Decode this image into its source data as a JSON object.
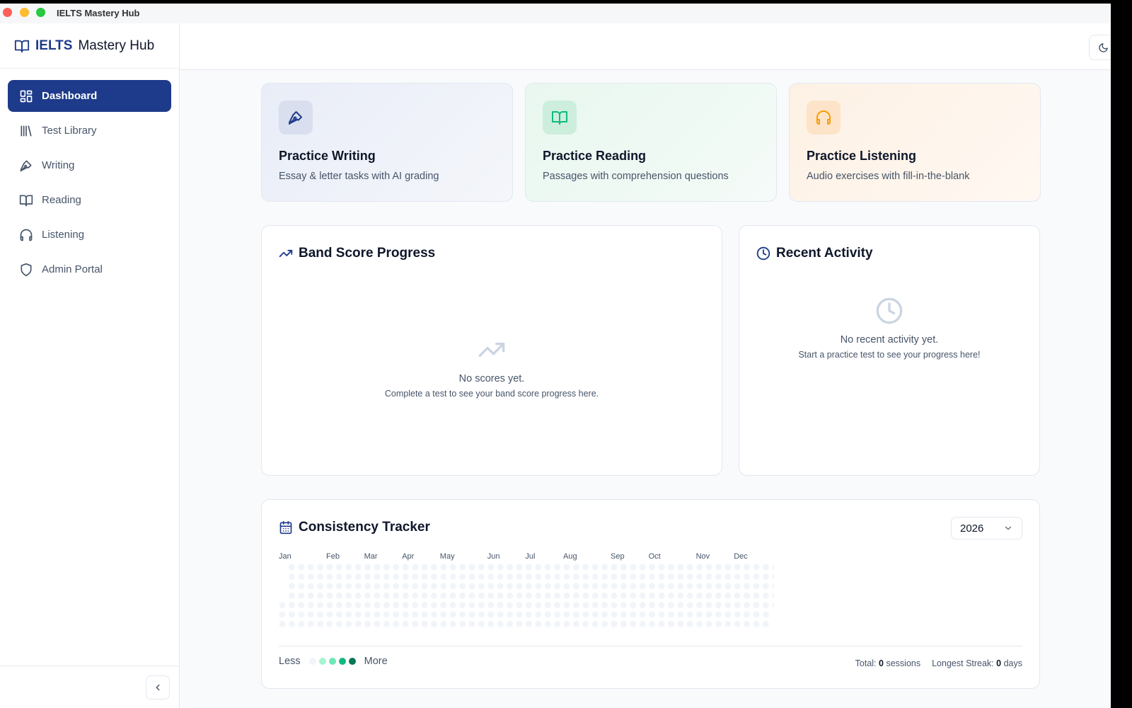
{
  "window": {
    "title": "IELTS Mastery Hub"
  },
  "brand": {
    "part1": "IELTS",
    "part2": "Mastery Hub"
  },
  "nav": [
    {
      "label": "Dashboard",
      "icon": "dashboard-icon",
      "active": true
    },
    {
      "label": "Test Library",
      "icon": "library-icon"
    },
    {
      "label": "Writing",
      "icon": "pen-icon"
    },
    {
      "label": "Reading",
      "icon": "book-icon"
    },
    {
      "label": "Listening",
      "icon": "headphones-icon"
    },
    {
      "label": "Admin Portal",
      "icon": "shield-icon"
    }
  ],
  "practice": [
    {
      "title": "Practice Writing",
      "desc": "Essay & letter tasks with AI grading",
      "icon": "pen-icon",
      "color": "#1e3a8a"
    },
    {
      "title": "Practice Reading",
      "desc": "Passages with comprehension questions",
      "icon": "book-icon",
      "color": "#10b981"
    },
    {
      "title": "Practice Listening",
      "desc": "Audio exercises with fill-in-the-blank",
      "icon": "headphones-icon",
      "color": "#f59e0b"
    }
  ],
  "progress": {
    "title": "Band Score Progress",
    "empty_title": "No scores yet.",
    "empty_sub": "Complete a test to see your band score progress here."
  },
  "activity": {
    "title": "Recent Activity",
    "empty_title": "No recent activity yet.",
    "empty_sub": "Start a practice test to see your progress here!"
  },
  "tracker": {
    "title": "Consistency Tracker",
    "year": "2026",
    "months": [
      "Jan",
      "Feb",
      "Mar",
      "Apr",
      "May",
      "Jun",
      "Jul",
      "Aug",
      "Sep",
      "Oct",
      "Nov",
      "Dec"
    ],
    "legend_less": "Less",
    "legend_more": "More",
    "legend_colors": [
      "#f1f5f9",
      "#a7f3d0",
      "#6ee7b7",
      "#10b981",
      "#047857"
    ],
    "total_label": "Total:",
    "total_value": "0",
    "total_unit": "sessions",
    "streak_label": "Longest Streak:",
    "streak_value": "0",
    "streak_unit": "days"
  },
  "colors": {
    "primary": "#1e3a8a",
    "cell_empty": "#f1f5f9"
  }
}
